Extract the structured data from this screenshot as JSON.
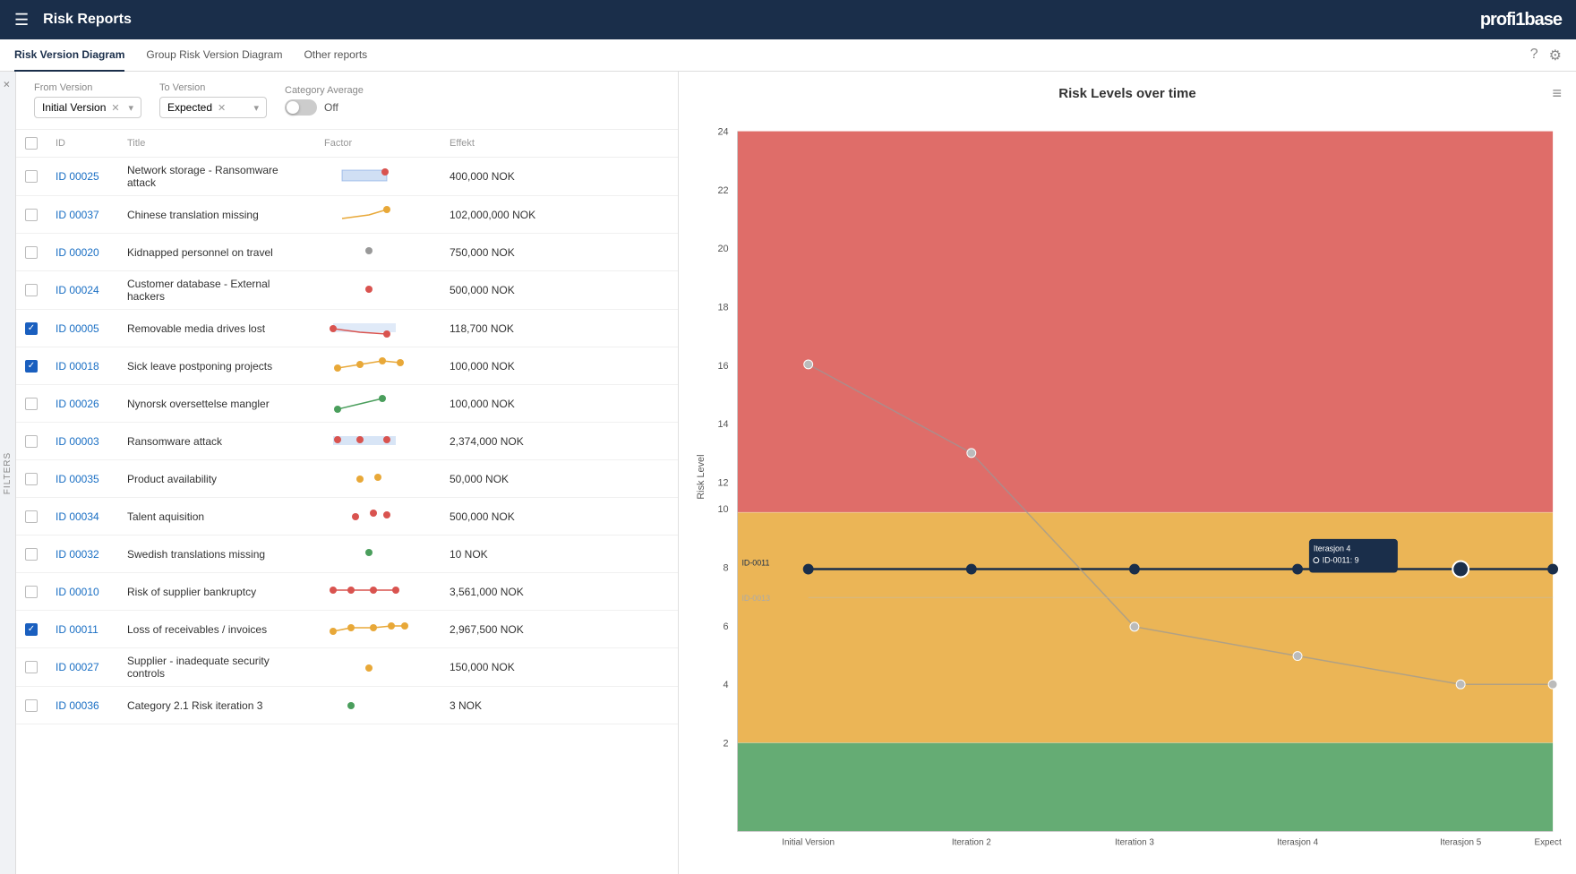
{
  "navbar": {
    "hamburger": "☰",
    "title": "Risk Reports",
    "logo": "profi1base"
  },
  "tabs": [
    {
      "id": "risk-version-diagram",
      "label": "Risk Version Diagram",
      "active": true
    },
    {
      "id": "group-risk-version-diagram",
      "label": "Group Risk Version Diagram",
      "active": false
    },
    {
      "id": "other-reports",
      "label": "Other reports",
      "active": false
    }
  ],
  "filters": {
    "from_version_label": "From Version",
    "from_version_value": "Initial Version",
    "to_version_label": "To Version",
    "to_version_value": "Expected",
    "category_average_label": "Category Average",
    "toggle_off_label": "Off",
    "filters_label": "FILTERS"
  },
  "table": {
    "columns": [
      "",
      "ID",
      "Title",
      "Factor",
      "Effekt"
    ],
    "rows": [
      {
        "id": "ID 00025",
        "title": "Network storage - Ransomware attack",
        "effekt": "400,000 NOK",
        "checked": false,
        "has_spark": true,
        "spark_type": "bar_up"
      },
      {
        "id": "ID 00037",
        "title": "Chinese translation missing",
        "effekt": "102,000,000 NOK",
        "checked": false,
        "has_spark": true,
        "spark_type": "line_up"
      },
      {
        "id": "ID 00020",
        "title": "Kidnapped personnel on travel",
        "effekt": "750,000 NOK",
        "checked": false,
        "has_spark": false,
        "spark_type": "dot"
      },
      {
        "id": "ID 00024",
        "title": "Customer database - External hackers",
        "effekt": "500,000 NOK",
        "checked": false,
        "has_spark": false,
        "spark_type": "dot_red"
      },
      {
        "id": "ID 00005",
        "title": "Removable media drives lost",
        "effekt": "118,700 NOK",
        "checked": true,
        "has_spark": true,
        "spark_type": "line_down"
      },
      {
        "id": "ID 00018",
        "title": "Sick leave postponing projects",
        "effekt": "100,000 NOK",
        "checked": true,
        "has_spark": true,
        "spark_type": "dots_orange"
      },
      {
        "id": "ID 00026",
        "title": "Nynorsk oversettelse mangler",
        "effekt": "100,000 NOK",
        "checked": false,
        "has_spark": true,
        "spark_type": "green_up"
      },
      {
        "id": "ID 00003",
        "title": "Ransomware attack",
        "effekt": "2,374,000 NOK",
        "checked": false,
        "has_spark": true,
        "spark_type": "bar_flat"
      },
      {
        "id": "ID 00035",
        "title": "Product availability",
        "effekt": "50,000 NOK",
        "checked": false,
        "has_spark": true,
        "spark_type": "dots_small"
      },
      {
        "id": "ID 00034",
        "title": "Talent aquisition",
        "effekt": "500,000 NOK",
        "checked": false,
        "has_spark": true,
        "spark_type": "dots_red_small"
      },
      {
        "id": "ID 00032",
        "title": "Swedish translations missing",
        "effekt": "10 NOK",
        "checked": false,
        "has_spark": true,
        "spark_type": "dot_green"
      },
      {
        "id": "ID 00010",
        "title": "Risk of supplier bankruptcy",
        "effekt": "3,561,000 NOK",
        "checked": false,
        "has_spark": true,
        "spark_type": "dots_red_multi"
      },
      {
        "id": "ID 00011",
        "title": "Loss of receivables / invoices",
        "effekt": "2,967,500 NOK",
        "checked": true,
        "has_spark": true,
        "spark_type": "dots_orange_multi"
      },
      {
        "id": "ID 00027",
        "title": "Supplier - inadequate security controls",
        "effekt": "150,000 NOK",
        "checked": false,
        "has_spark": true,
        "spark_type": "dot_orange_single"
      },
      {
        "id": "ID 00036",
        "title": "Category 2.1 Risk iteration 3",
        "effekt": "3 NOK",
        "checked": false,
        "has_spark": true,
        "spark_type": "dot_partial"
      }
    ]
  },
  "chart": {
    "title": "Risk Levels over time",
    "menu_icon": "≡",
    "y_axis_label": "Risk Level",
    "x_labels": [
      "Initial Version",
      "Iteration 2",
      "Iteration 3",
      "Iterasjon 4",
      "Iterasjon 5",
      "Expected"
    ],
    "y_ticks": [
      2,
      4,
      6,
      8,
      10,
      12,
      14,
      16,
      18,
      20,
      22,
      24
    ],
    "tooltip": {
      "header": "Iterasjon 4",
      "item": "ID-0011: 9"
    },
    "id_label_left": "ID-0011",
    "id_label_left2": "ID-0013"
  },
  "colors": {
    "red_zone": "#d9534f",
    "orange_zone": "#e8a838",
    "green_zone": "#4a9e5c",
    "nav_bg": "#1a2e4a",
    "accent_blue": "#1a6fc4"
  }
}
